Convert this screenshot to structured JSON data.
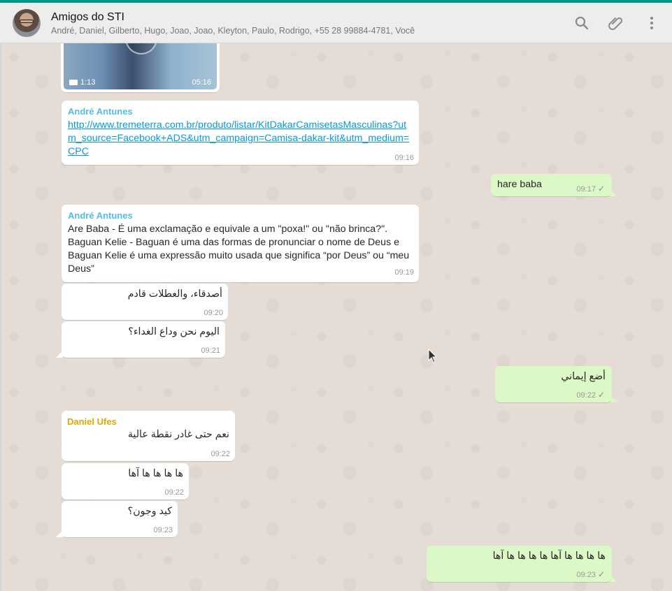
{
  "header": {
    "title": "Amigos do STI",
    "participants": "André, Daniel, Gilberto, Hugo, Joao, Joao, Kleyton, Paulo, Rodrigo, +55 28 99884-4781, Você"
  },
  "icons": {
    "search": "search-icon",
    "attach": "paperclip-icon",
    "menu": "more-vertical-icon"
  },
  "video": {
    "duration": "1:13",
    "time": "05:16"
  },
  "messages": [
    {
      "dir": "in",
      "sender": "André Antunes",
      "link": "http://www.tremeterra.com.br/produto/listar/KitDakarCamisetasMasculinas?utm_source=Facebook+ADS&utm_campaign=Camisa-dakar-kit&utm_medium=CPC",
      "time": "09:16"
    },
    {
      "dir": "out",
      "text": "hare baba",
      "time": "09:17"
    },
    {
      "dir": "in",
      "sender": "André Antunes",
      "text": "Are Baba - É uma exclamação e equivale a um \"poxa!\" ou \"não brinca?\". Baguan Kelie - Baguan é uma das formas de pronunciar o nome de Deus e Baguan Kelie é uma expressão muito usada que significa “por Deus” ou “meu Deus”",
      "time": "09:19"
    },
    {
      "dir": "in",
      "text": "أصدقاء، والعطلات قادم",
      "time": "09:20"
    },
    {
      "dir": "in",
      "text": "اليوم نحن وداع الغداء؟",
      "time": "09:21"
    },
    {
      "dir": "out",
      "text": "أضع إيماني",
      "time": "09:22"
    },
    {
      "dir": "in",
      "sender": "Daniel Ufes",
      "text": "نعم حتى غادر نقطة عالية",
      "time": "09:22"
    },
    {
      "dir": "in",
      "text": "ها ها ها ها آها",
      "time": "09:22"
    },
    {
      "dir": "in",
      "text": "كيد وجون؟",
      "time": "09:23"
    },
    {
      "dir": "out",
      "text": "ها ها ها ها آها ها ها ها ها آها",
      "time": "09:23"
    }
  ],
  "colors": {
    "header_accent": "#009688",
    "outgoing": "#dcf8c6",
    "incoming": "#ffffff",
    "sender_andre": "#53bdeb",
    "sender_daniel": "#e0a800"
  }
}
